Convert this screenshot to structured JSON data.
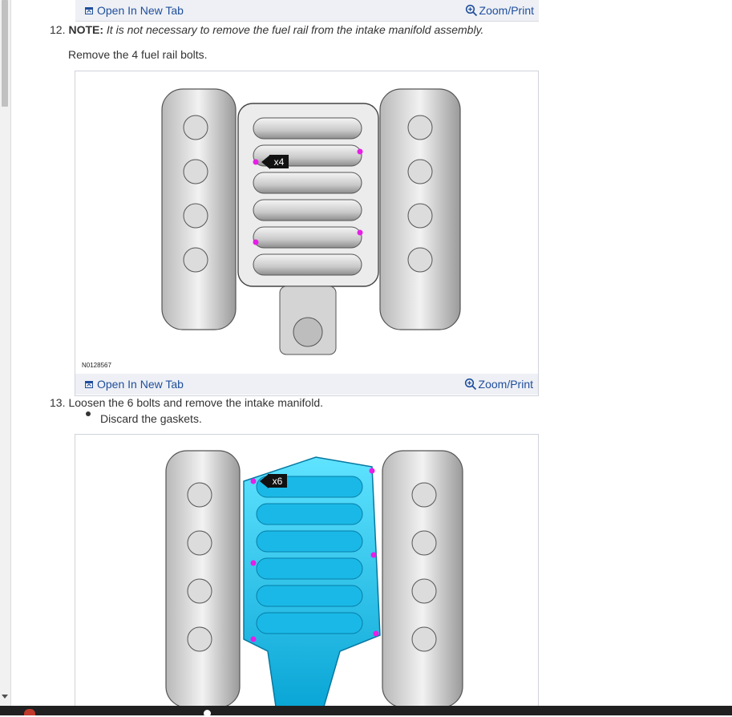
{
  "figure_links": {
    "open_new_tab": "Open In New Tab",
    "zoom_print": "Zoom/Print"
  },
  "steps": [
    {
      "number": "12.",
      "note_label": "NOTE:",
      "note_text": "It is not necessary to remove the fuel rail from the intake manifold assembly.",
      "instruction": "Remove the 4 fuel rail bolts."
    },
    {
      "number": "13.",
      "instruction": "Loosen the 6 bolts and remove the intake manifold.",
      "bullets": [
        "Discard the gaskets."
      ]
    }
  ],
  "figures": [
    {
      "id": "N0128567",
      "callout": "x4"
    },
    {
      "callout": "x6"
    }
  ],
  "colors": {
    "link": "#1f4e9c",
    "bar_bg": "#eef0f5",
    "manifold_highlight": "#1ec8ee",
    "bolt_marker": "#e61ee6"
  }
}
